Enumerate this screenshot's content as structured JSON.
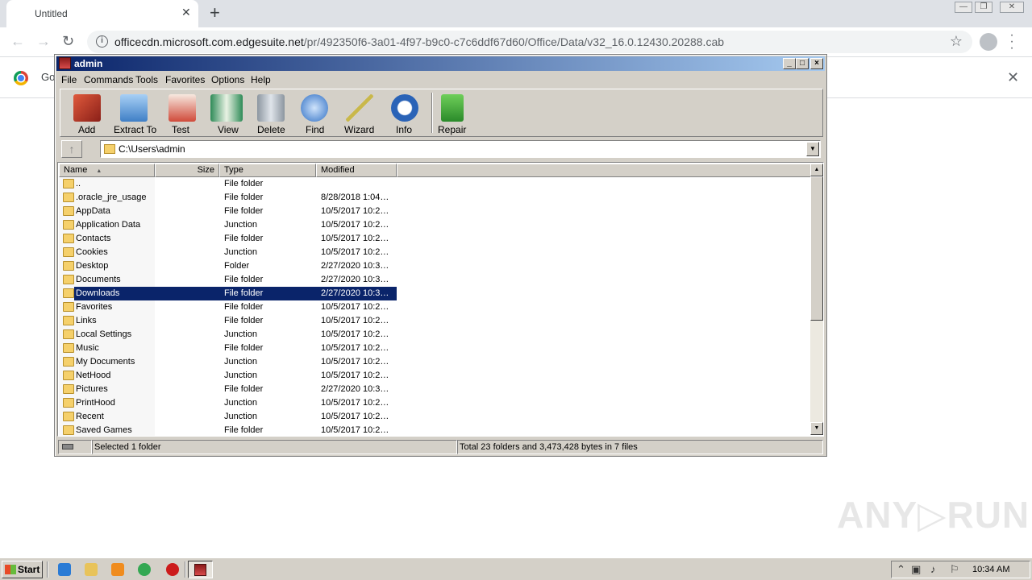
{
  "browser": {
    "tab_title": "Untitled",
    "tab_close": "✕",
    "new_tab": "+",
    "url_domain": "officecdn.microsoft.com.edgesuite.net",
    "url_path": "/pr/492350f6-3a01-4f97-b9c0-c7c6ddf67d60/Office/Data/v32_16.0.12430.20288.cab",
    "infobar_text": "Go",
    "window_controls": [
      "—",
      "❐",
      "✕"
    ]
  },
  "winrar": {
    "title": "admin",
    "title_buttons": [
      "_",
      "□",
      "×"
    ],
    "menu": [
      "File",
      "Commands",
      "Tools",
      "Favorites",
      "Options",
      "Help"
    ],
    "toolbar": [
      {
        "label": "Add",
        "icon": "archive-add-icon",
        "color": "#b5322b"
      },
      {
        "label": "Extract To",
        "icon": "folder-extract-icon",
        "color": "#4a90d9"
      },
      {
        "label": "Test",
        "icon": "clipboard-test-icon",
        "color": "#c0392b"
      },
      {
        "label": "View",
        "icon": "book-view-icon",
        "color": "#2e8b57"
      },
      {
        "label": "Delete",
        "icon": "trash-icon",
        "color": "#7f8c9a"
      },
      {
        "label": "Find",
        "icon": "magnifier-icon",
        "color": "#2f6fc4"
      },
      {
        "label": "Wizard",
        "icon": "magic-wand-icon",
        "color": "#c9b84a"
      },
      {
        "label": "Info",
        "icon": "info-icon",
        "color": "#2a63b7"
      },
      {
        "label": "Repair",
        "icon": "repair-icon",
        "color": "#3a9a3a"
      }
    ],
    "address": "C:\\Users\\admin",
    "columns": [
      "Name",
      "Size",
      "Type",
      "Modified"
    ],
    "sort_indicator": "▲",
    "files": [
      {
        "name": "..",
        "type": "File folder",
        "modified": ""
      },
      {
        "name": ".oracle_jre_usage",
        "type": "File folder",
        "modified": "8/28/2018 1:04…"
      },
      {
        "name": "AppData",
        "type": "File folder",
        "modified": "10/5/2017 10:2…"
      },
      {
        "name": "Application Data",
        "type": "Junction",
        "modified": "10/5/2017 10:2…"
      },
      {
        "name": "Contacts",
        "type": "File folder",
        "modified": "10/5/2017 10:2…"
      },
      {
        "name": "Cookies",
        "type": "Junction",
        "modified": "10/5/2017 10:2…"
      },
      {
        "name": "Desktop",
        "type": "Folder",
        "modified": "2/27/2020 10:3…"
      },
      {
        "name": "Documents",
        "type": "File folder",
        "modified": "2/27/2020 10:3…"
      },
      {
        "name": "Downloads",
        "type": "File folder",
        "modified": "2/27/2020 10:3…",
        "selected": true
      },
      {
        "name": "Favorites",
        "type": "File folder",
        "modified": "10/5/2017 10:2…"
      },
      {
        "name": "Links",
        "type": "File folder",
        "modified": "10/5/2017 10:2…"
      },
      {
        "name": "Local Settings",
        "type": "Junction",
        "modified": "10/5/2017 10:2…"
      },
      {
        "name": "Music",
        "type": "File folder",
        "modified": "10/5/2017 10:2…"
      },
      {
        "name": "My Documents",
        "type": "Junction",
        "modified": "10/5/2017 10:2…"
      },
      {
        "name": "NetHood",
        "type": "Junction",
        "modified": "10/5/2017 10:2…"
      },
      {
        "name": "Pictures",
        "type": "File folder",
        "modified": "2/27/2020 10:3…"
      },
      {
        "name": "PrintHood",
        "type": "Junction",
        "modified": "10/5/2017 10:2…"
      },
      {
        "name": "Recent",
        "type": "Junction",
        "modified": "10/5/2017 10:2…"
      },
      {
        "name": "Saved Games",
        "type": "File folder",
        "modified": "10/5/2017 10:2…"
      }
    ],
    "status_left": "Selected 1 folder",
    "status_right": "Total 23 folders and 3,473,428 bytes in 7 files"
  },
  "watermark": "ANY▷RUN",
  "taskbar": {
    "start_label": "Start",
    "clock": "10:34 AM",
    "quick_launch": [
      {
        "icon": "ie-icon",
        "color": "#2a7bd5"
      },
      {
        "icon": "explorer-icon",
        "color": "#e8c35a"
      },
      {
        "icon": "media-player-icon",
        "color": "#f08c1e"
      },
      {
        "icon": "chrome-icon",
        "color": "#34a853"
      },
      {
        "icon": "opera-icon",
        "color": "#cc1b1b"
      }
    ]
  }
}
